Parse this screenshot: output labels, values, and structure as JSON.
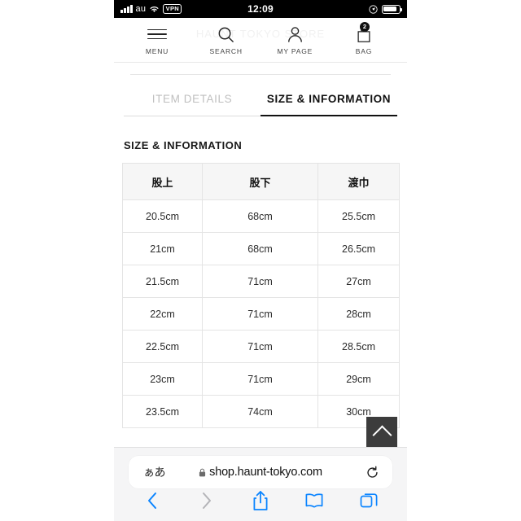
{
  "status_bar": {
    "carrier": "au",
    "vpn_badge": "VPN",
    "time": "12:09",
    "signal_icon": "signal-bars-icon",
    "wifi_icon": "wifi-icon",
    "location_icon": "location-arrow-icon",
    "battery_icon": "battery-icon"
  },
  "site_header": {
    "watermark": "HAUNT  TOKYO  STORE",
    "nav_items": [
      {
        "label": "MENU",
        "icon": "hamburger-menu-icon",
        "badge": ""
      },
      {
        "label": "SEARCH",
        "icon": "search-icon",
        "badge": ""
      },
      {
        "label": "MY PAGE",
        "icon": "person-icon",
        "badge": ""
      },
      {
        "label": "BAG",
        "icon": "shopping-bag-icon",
        "badge": "2"
      }
    ]
  },
  "tabs": [
    {
      "label": "ITEM DETAILS",
      "active": false
    },
    {
      "label": "SIZE & INFORMATION",
      "active": true
    }
  ],
  "section": {
    "title": "SIZE & INFORMATION"
  },
  "size_table": {
    "headers": [
      "股上",
      "股下",
      "渡巾"
    ],
    "rows": [
      [
        "20.5cm",
        "68cm",
        "25.5cm"
      ],
      [
        "21cm",
        "68cm",
        "26.5cm"
      ],
      [
        "21.5cm",
        "71cm",
        "27cm"
      ],
      [
        "22cm",
        "71cm",
        "28cm"
      ],
      [
        "22.5cm",
        "71cm",
        "28.5cm"
      ],
      [
        "23cm",
        "71cm",
        "29cm"
      ],
      [
        "23.5cm",
        "74cm",
        "30cm"
      ]
    ]
  },
  "scroll_to_top": {
    "icon": "chevron-up-icon",
    "background": "#3c3c3c"
  },
  "browser": {
    "text_size_button": "ぁあ",
    "lock_icon": "lock-icon",
    "url": "shop.haunt-tokyo.com",
    "reload_icon": "reload-icon",
    "toolbar": [
      {
        "name": "back",
        "icon": "chevron-left-icon",
        "enabled": true
      },
      {
        "name": "forward",
        "icon": "chevron-right-icon",
        "enabled": false
      },
      {
        "name": "share",
        "icon": "share-icon",
        "enabled": true
      },
      {
        "name": "bookmarks",
        "icon": "book-icon",
        "enabled": true
      },
      {
        "name": "tabs",
        "icon": "tabs-icon",
        "enabled": true
      }
    ],
    "accent_color": "#0a84ff"
  }
}
